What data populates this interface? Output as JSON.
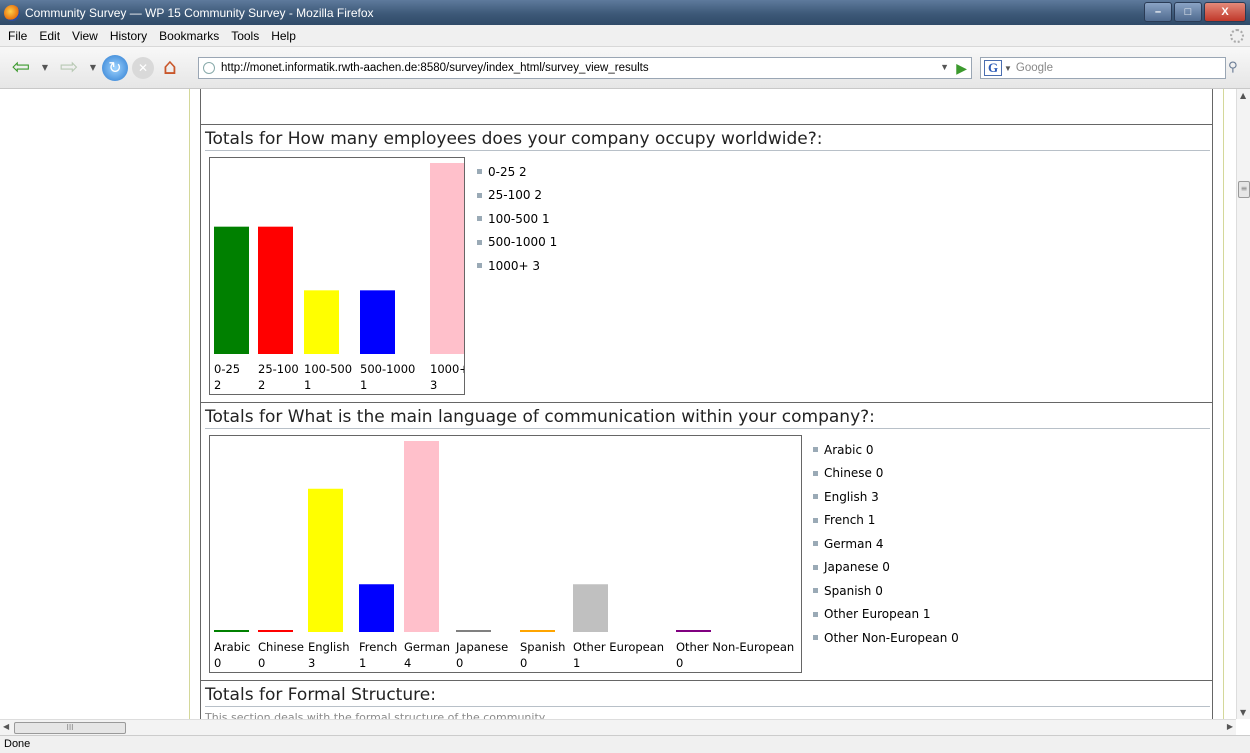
{
  "window": {
    "title": "Community Survey — WP 15 Community Survey - Mozilla Firefox",
    "minimize": "–",
    "maximize": "□",
    "close": "X"
  },
  "menu": [
    "File",
    "Edit",
    "View",
    "History",
    "Bookmarks",
    "Tools",
    "Help"
  ],
  "nav": {
    "url": "http://monet.informatik.rwth-aachen.de:8580/survey/index_html/survey_view_results",
    "search_placeholder": "Google",
    "search_engine_letter": "G"
  },
  "status": "Done",
  "sections": [
    {
      "title": "Totals for How many employees does your company occupy worldwide?:",
      "legend": [
        "0-25 2",
        "25-100 2",
        "100-500 1",
        "500-1000 1",
        "1000+ 3"
      ]
    },
    {
      "title": "Totals for What is the main language of communication within your company?:",
      "legend": [
        "Arabic 0",
        "Chinese 0",
        "English 3",
        "French 1",
        "German 4",
        "Japanese 0",
        "Spanish 0",
        "Other European 1",
        "Other Non-European 0"
      ]
    },
    {
      "title": "Totals for Formal Structure:",
      "description": "This section deals with the formal structure of the community."
    }
  ],
  "chart_data": [
    {
      "type": "bar",
      "categories": [
        "0-25",
        "25-100",
        "100-500",
        "500-1000",
        "1000+"
      ],
      "values": [
        2,
        2,
        1,
        1,
        3
      ],
      "colors": [
        "#008000",
        "#ff0000",
        "#ffff00",
        "#0000ff",
        "#ffc0cb"
      ]
    },
    {
      "type": "bar",
      "categories": [
        "Arabic",
        "Chinese",
        "English",
        "French",
        "German",
        "Japanese",
        "Spanish",
        "Other European",
        "Other Non-European"
      ],
      "values": [
        0,
        0,
        3,
        1,
        4,
        0,
        0,
        1,
        0
      ],
      "colors": [
        "#008000",
        "#ff0000",
        "#ffff00",
        "#0000ff",
        "#ffc0cb",
        "#808080",
        "#ffa500",
        "#c0c0c0",
        "#800080"
      ]
    }
  ]
}
